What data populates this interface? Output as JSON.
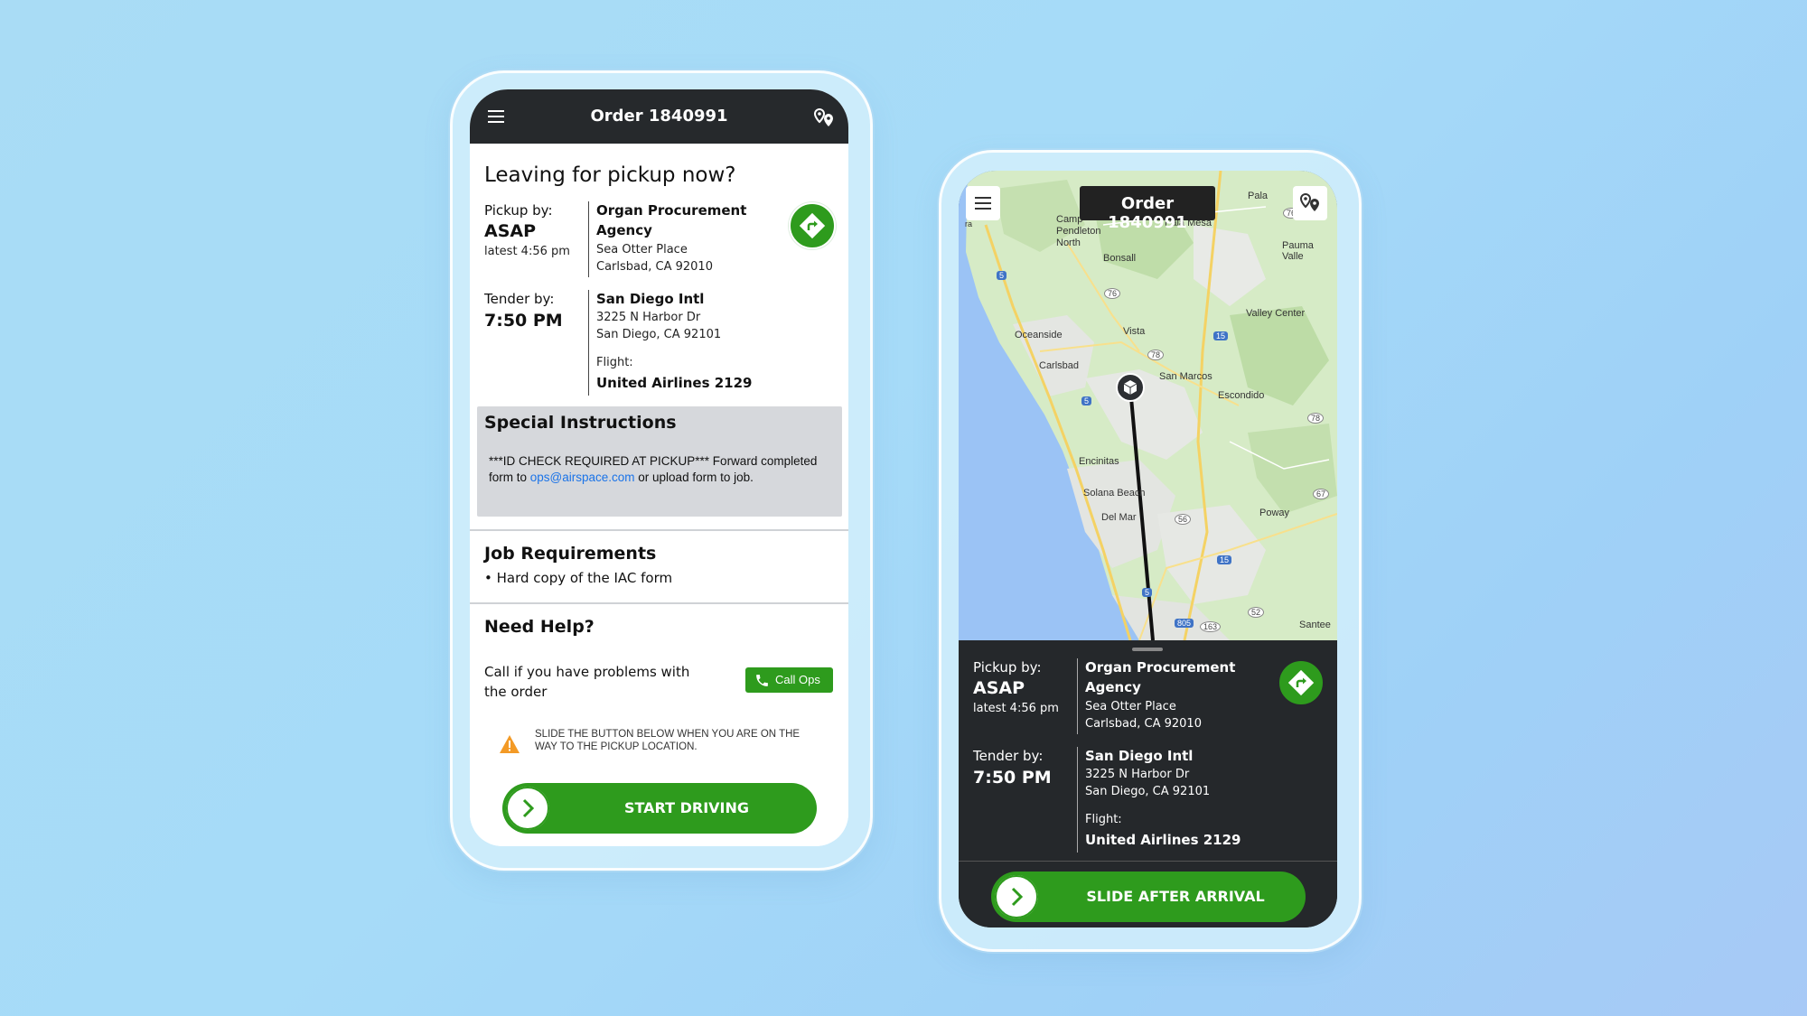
{
  "left_phone": {
    "header": {
      "title": "Order 1840991",
      "menu_icon": "menu-icon",
      "map_pins_icon": "map-pins-icon"
    },
    "heading": "Leaving for pickup now?",
    "pickup": {
      "label": "Pickup by:",
      "time": "ASAP",
      "latest": "latest 4:56 pm",
      "name_line1": "Organ Procurement",
      "name_line2": "Agency",
      "address1": "Sea Otter Place",
      "address2": "Carlsbad, CA 92010"
    },
    "tender": {
      "label": "Tender by:",
      "time": "7:50 PM",
      "name": "San Diego Intl",
      "address1": "3225 N Harbor Dr",
      "address2": "San Diego, CA 92101",
      "flight_label": "Flight:",
      "flight": "United Airlines 2129"
    },
    "special_instructions": {
      "title": "Special Instructions",
      "text_before": "***ID CHECK REQUIRED AT PICKUP*** Forward completed form to ",
      "email": "ops@airspace.com",
      "text_after": " or upload form to job."
    },
    "job_requirements": {
      "title": "Job Requirements",
      "item": "• Hard copy of the IAC form"
    },
    "help": {
      "title": "Need Help?",
      "text": "Call if you have problems with the order",
      "call_button": "Call Ops"
    },
    "warning": "SLIDE THE BUTTON BELOW WHEN YOU ARE ON THE WAY TO THE PICKUP LOCATION.",
    "slide_button": "START DRIVING"
  },
  "right_phone": {
    "order_chip": "Order 1840991",
    "map_labels": {
      "pala": "Pala",
      "camp_pendleton": "Camp\nPendleton\nNorth",
      "pala_mesa": "Pala Mesa",
      "pauma_valley": "Pauma Valle",
      "bonsall": "Bonsall",
      "valley_center": "Valley Center",
      "oceanside": "Oceanside",
      "vista": "Vista",
      "carlsbad": "Carlsbad",
      "san_marcos": "San Marcos",
      "escondido": "Escondido",
      "encinitas": "Encinitas",
      "solana_beach": "Solana Beach",
      "del_mar": "Del Mar",
      "poway": "Poway",
      "santee": "Santee"
    },
    "route_badges": [
      "5",
      "76",
      "15",
      "78",
      "5",
      "78",
      "67",
      "56",
      "15",
      "5",
      "805",
      "163",
      "52",
      "76",
      "ra"
    ],
    "pickup": {
      "label": "Pickup by:",
      "time": "ASAP",
      "latest": "latest 4:56 pm",
      "name_line1": "Organ Procurement",
      "name_line2": "Agency",
      "address1": "Sea Otter Place",
      "address2": "Carlsbad, CA 92010"
    },
    "tender": {
      "label": "Tender by:",
      "time": "7:50 PM",
      "name": "San Diego Intl",
      "address1": "3225 N Harbor Dr",
      "address2": "San Diego, CA 92101",
      "flight_label": "Flight:",
      "flight": "United Airlines 2129"
    },
    "slide_button": "SLIDE AFTER ARRIVAL"
  },
  "colors": {
    "green": "#2e9b1d",
    "dark": "#26292c",
    "background": "#a6dbf8",
    "link": "#1a73e8"
  }
}
